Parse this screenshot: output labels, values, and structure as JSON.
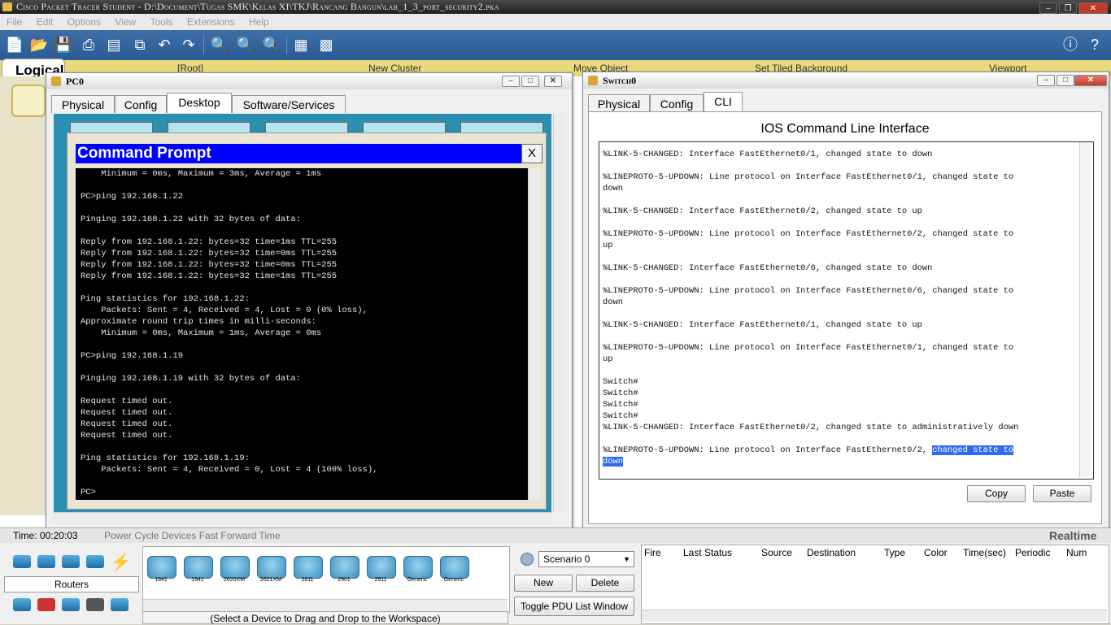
{
  "app": {
    "title": "Cisco Packet Tracer Student - D:\\Document\\Tugas SMK\\Kelas XI\\TKJ\\Rancang Bangun\\lab_1_3_port_security2.pka"
  },
  "menu": [
    "File",
    "Edit",
    "Options",
    "View",
    "Tools",
    "Extensions",
    "Help"
  ],
  "workspace": {
    "tab": "Logical",
    "root": "[Root]",
    "new_cluster": "New Cluster",
    "move_object": "Move Object",
    "set_tiled_background": "Set Tiled Background",
    "viewport": "Viewport"
  },
  "pc0": {
    "title": "PC0",
    "tabs": [
      "Physical",
      "Config",
      "Desktop",
      "Software/Services"
    ],
    "active_tab": "Desktop",
    "cmd": {
      "title": "Command Prompt",
      "close": "X",
      "lines": [
        "    Minimum = 0ms, Maximum = 3ms, Average = 1ms",
        "",
        "PC>ping 192.168.1.22",
        "",
        "Pinging 192.168.1.22 with 32 bytes of data:",
        "",
        "Reply from 192.168.1.22: bytes=32 time=1ms TTL=255",
        "Reply from 192.168.1.22: bytes=32 time=0ms TTL=255",
        "Reply from 192.168.1.22: bytes=32 time=0ms TTL=255",
        "Reply from 192.168.1.22: bytes=32 time=1ms TTL=255",
        "",
        "Ping statistics for 192.168.1.22:",
        "    Packets: Sent = 4, Received = 4, Lost = 0 (0% loss),",
        "Approximate round trip times in milli-seconds:",
        "    Minimum = 0ms, Maximum = 1ms, Average = 0ms",
        "",
        "PC>ping 192.168.1.19",
        "",
        "Pinging 192.168.1.19 with 32 bytes of data:",
        "",
        "Request timed out.",
        "Request timed out.",
        "Request timed out.",
        "Request timed out.",
        "",
        "Ping statistics for 192.168.1.19:",
        "    Packets: Sent = 4, Received = 0, Lost = 4 (100% loss),",
        "",
        "PC>"
      ]
    }
  },
  "switch0": {
    "title": "Switch0",
    "tabs": [
      "Physical",
      "Config",
      "CLI"
    ],
    "active_tab": "CLI",
    "heading": "IOS Command Line Interface",
    "lines": [
      "%LINK-5-CHANGED: Interface FastEthernet0/1, changed state to down",
      "",
      "%LINEPROTO-5-UPDOWN: Line protocol on Interface FastEthernet0/1, changed state to",
      "down",
      "",
      "%LINK-5-CHANGED: Interface FastEthernet0/2, changed state to up",
      "",
      "%LINEPROTO-5-UPDOWN: Line protocol on Interface FastEthernet0/2, changed state to",
      "up",
      "",
      "%LINK-5-CHANGED: Interface FastEthernet0/6, changed state to down",
      "",
      "%LINEPROTO-5-UPDOWN: Line protocol on Interface FastEthernet0/6, changed state to",
      "down",
      "",
      "%LINK-5-CHANGED: Interface FastEthernet0/1, changed state to up",
      "",
      "%LINEPROTO-5-UPDOWN: Line protocol on Interface FastEthernet0/1, changed state to",
      "up",
      "",
      "Switch#",
      "Switch#",
      "Switch#",
      "Switch#",
      "%LINK-5-CHANGED: Interface FastEthernet0/2, changed state to administratively down"
    ],
    "last_line_prefix": "%LINEPROTO-5-UPDOWN: Line protocol on Interface FastEthernet0/2, ",
    "highlight_a": "changed state to",
    "highlight_b": "down",
    "copy": "Copy",
    "paste": "Paste"
  },
  "status": {
    "time": "Time: 00:20:03",
    "power": "Power Cycle Devices  Fast Forward Time",
    "realtime": "Realtime"
  },
  "bottom": {
    "category": "Routers",
    "devices": [
      "1841",
      "1941",
      "2620XM",
      "2621XM",
      "2811",
      "2901",
      "2911",
      "Generic",
      "Generic"
    ],
    "hint": "(Select a Device to Drag and Drop to the Workspace)",
    "scenario": "Scenario 0",
    "new": "New",
    "delete": "Delete",
    "toggle": "Toggle PDU List Window",
    "columns": [
      "Fire",
      "Last Status",
      "Source",
      "Destination",
      "Type",
      "Color",
      "Time(sec)",
      "Periodic",
      "Num"
    ]
  }
}
